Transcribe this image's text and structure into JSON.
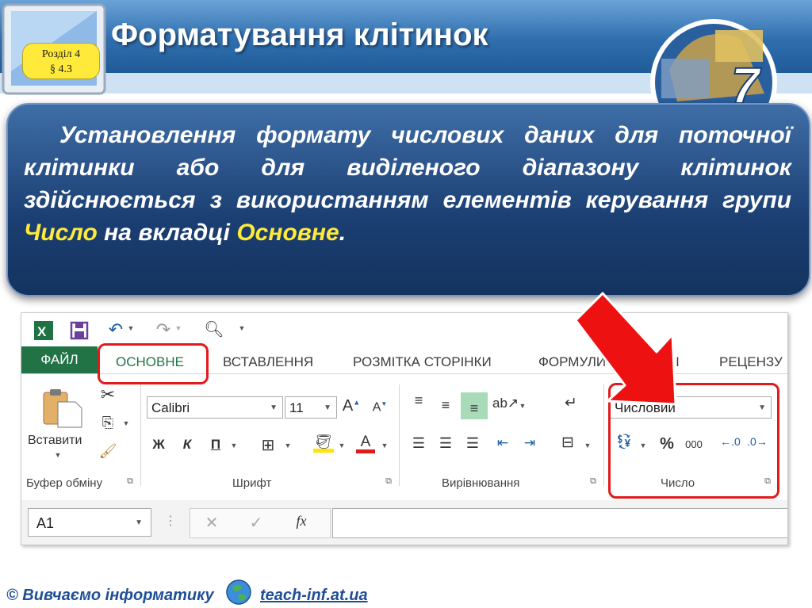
{
  "header": {
    "title": "Форматування клітинок",
    "badge_line1": "Розділ 4",
    "badge_line2": "§ 4.3",
    "grade": "7"
  },
  "info": {
    "text_before": "Установлення формату числових даних для поточної клітинки або для виділеного діапазону клітинок здійснюється з використанням елементів керування групи ",
    "highlight1": "Число",
    "text_middle": " на вкладці ",
    "highlight2": "Основне",
    "text_after": "."
  },
  "excel": {
    "tabs": {
      "file": "ФАЙЛ",
      "home": "ОСНОВНЕ",
      "insert": "ВСТАВЛЕННЯ",
      "layout": "РОЗМІТКА СТОРІНКИ",
      "formulas": "ФОРМУЛИ",
      "data": "ДАНІ",
      "review": "РЕЦЕНЗУ"
    },
    "clipboard": {
      "paste_label": "Вставити",
      "group_label": "Буфер обміну"
    },
    "font": {
      "name": "Calibri",
      "size": "11",
      "bold": "Ж",
      "italic": "К",
      "underline": "П",
      "group_label": "Шрифт"
    },
    "alignment": {
      "group_label": "Вирівнювання"
    },
    "number": {
      "format": "Числовий",
      "percent": "%",
      "thousands": "000",
      "group_label": "Число"
    },
    "formula_bar": {
      "name_box": "A1",
      "fx": "fx"
    }
  },
  "footer": {
    "credit": "© Вивчаємо інформатику",
    "link": "teach-inf.at.ua"
  },
  "colors": {
    "accent_red": "#e01b1b",
    "highlight_yellow": "#ffe93a",
    "excel_green": "#217346",
    "panel_blue": "#1b3f73"
  }
}
